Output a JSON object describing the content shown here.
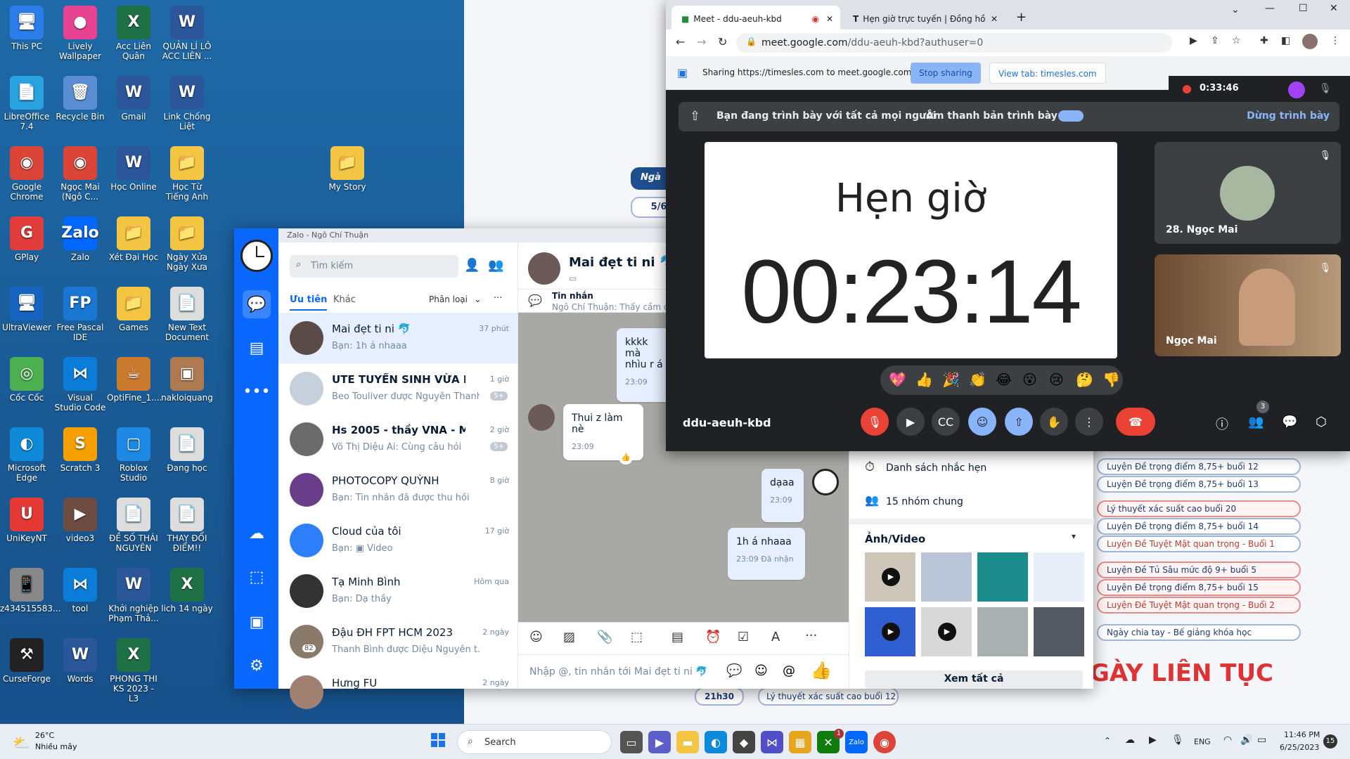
{
  "desktop": {
    "icons": [
      {
        "label": "This PC",
        "glyph": "🖥"
      },
      {
        "label": "Lively Wallpaper",
        "glyph": "●"
      },
      {
        "label": "Acc Liên Quân",
        "glyph": "X"
      },
      {
        "label": "QUẢN LÍ LÔ ACC LIÊN ...",
        "glyph": "W"
      },
      {
        "label": "LibreOffice 7.4",
        "glyph": "📄"
      },
      {
        "label": "Recycle Bin",
        "glyph": "🗑"
      },
      {
        "label": "Gmail",
        "glyph": "W"
      },
      {
        "label": "Link Chống Liệt",
        "glyph": "W"
      },
      {
        "label": "Google Chrome",
        "glyph": "◉"
      },
      {
        "label": "Ngọc Mai (Ngô C...",
        "glyph": "◉"
      },
      {
        "label": "Học Online",
        "glyph": "W"
      },
      {
        "label": "Học Từ Tiếng Anh",
        "glyph": "📁"
      },
      {
        "label": "My Story",
        "glyph": "📁"
      },
      {
        "label": "GPlay",
        "glyph": "G"
      },
      {
        "label": "Zalo",
        "glyph": "Zalo"
      },
      {
        "label": "Xét Đại Học",
        "glyph": "📁"
      },
      {
        "label": "Ngày Xửa Ngày Xưa",
        "glyph": "📁"
      },
      {
        "label": "UltraViewer",
        "glyph": "🖥"
      },
      {
        "label": "Free Pascal IDE",
        "glyph": "FP"
      },
      {
        "label": "Games",
        "glyph": "📁"
      },
      {
        "label": "New Text Document",
        "glyph": "📄"
      },
      {
        "label": "Cốc Cốc",
        "glyph": "◎"
      },
      {
        "label": "Visual Studio Code",
        "glyph": "⋈"
      },
      {
        "label": "OptiFine_1....",
        "glyph": "☕"
      },
      {
        "label": "nakloiquang",
        "glyph": "▣"
      },
      {
        "label": "Microsoft Edge",
        "glyph": "◐"
      },
      {
        "label": "Scratch 3",
        "glyph": "S"
      },
      {
        "label": "Roblox Studio",
        "glyph": "▢"
      },
      {
        "label": "Đang học",
        "glyph": "📄"
      },
      {
        "label": "UniKeyNT",
        "glyph": "U"
      },
      {
        "label": "video3",
        "glyph": "▶"
      },
      {
        "label": "ĐỀ SỐ THÁI NGUYÊN",
        "glyph": "📄"
      },
      {
        "label": "THAY ĐỔI ĐIỂM!!",
        "glyph": "📄"
      },
      {
        "label": "z434515583...",
        "glyph": "📱"
      },
      {
        "label": "tool",
        "glyph": "⋈"
      },
      {
        "label": "Khởi nghiệp Phạm Thả...",
        "glyph": "W"
      },
      {
        "label": "lich 14 ngày",
        "glyph": "X"
      },
      {
        "label": "CurseForge",
        "glyph": "⚒"
      },
      {
        "label": "Words",
        "glyph": "W"
      },
      {
        "label": "PHONG THI KS 2023 - L3",
        "glyph": "X"
      }
    ]
  },
  "website": {
    "tag1": "Ngà",
    "tag2": "5/6",
    "items": [
      "Luyện Đề trọng điểm 8,75+ buổi 12",
      "Luyện Đề trọng điểm 8,75+ buổi 13",
      "Lý thuyết xác suất cao buổi 20",
      "Luyện Đề trọng điểm 8,75+ buổi 14",
      "Luyện Đề Tuyệt Mật quan trọng - Buổi 1",
      "Luyện Đề Tủ Sâu mức độ 9+ buổi 5",
      "Luyện Đề trọng điểm 8,75+ buổi 15",
      "Luyện Đề Tuyệt Mật quan trọng - Buổi 2",
      "Ngày chia tay - Bế giảng khóa học"
    ],
    "banner": "GÀY LIÊN TỤC",
    "bottom_time": "21h30",
    "bottom_item": "Lý thuyết xác suất cao buổi 12"
  },
  "zalo": {
    "title": "Zalo - Ngô Chí Thuận",
    "search_placeholder": "Tìm kiếm",
    "tab_priority": "Ưu tiên",
    "tab_other": "Khác",
    "classify": "Phân loại",
    "conversations": [
      {
        "name": "Mai đẹt ti ni 🐬",
        "preview": "Bạn: 1h á nhaaa",
        "time": "37 phút"
      },
      {
        "name": "UTE TUYỂN SINH VỪA LÀ...",
        "preview": "Beo Touliver được Nguyễn Thanh ...",
        "time": "1 giờ"
      },
      {
        "name": "Hs 2005 - thầy VNA - Ma...",
        "preview": "Võ Thị Diệu Ái: Cùng câu hỏi",
        "time": "2 giờ"
      },
      {
        "name": "PHOTOCOPY QUỲNH",
        "preview": "Bạn: Tin nhắn đã được thu hồi",
        "time": "8 giờ"
      },
      {
        "name": "Cloud của tôi",
        "preview": "Bạn: ▣ Video",
        "time": "17 giờ"
      },
      {
        "name": "Tạ Minh Bình",
        "preview": "Bạn: Dạ thầy",
        "time": "Hôm qua"
      },
      {
        "name": "Đậu ĐH FPT HCM 2023",
        "preview": "Thanh Bình được Diệu Nguyễn t...",
        "time": "2 ngày"
      },
      {
        "name": "Hưng FU",
        "preview": "",
        "time": "2 ngày"
      }
    ],
    "badge_5": "5+",
    "badge_82": "82",
    "chat": {
      "name": "Mai đẹt ti ni 🐬",
      "pinned_label": "Tin nhắn",
      "pinned_text": "Ngô Chí Thuận: Thấy cầm c",
      "messages": [
        {
          "text": "kkkk mà nhìu r á",
          "time": "23:09"
        },
        {
          "text": "Thui z làm nè",
          "time": "23:09"
        },
        {
          "text": "dạaa",
          "time": "23:09"
        },
        {
          "text": "1h á nhaaa",
          "time": "23:09",
          "status": "Đã nhận"
        }
      ],
      "input_placeholder": "Nhập @, tin nhắn tới Mai đẹt ti ni 🐬"
    },
    "info": {
      "reminders": "Danh sách nhắc hẹn",
      "groups": "15 nhóm chung",
      "media_title": "Ảnh/Video",
      "see_all": "Xem tất cả"
    }
  },
  "chrome": {
    "tab1": "Meet - ddu-aeuh-kbd",
    "tab2": "Hẹn giờ trực tuyến | Đồng hồ",
    "url_host": "meet.google.com",
    "url_path": "/ddu-aeuh-kbd?authuser=0",
    "sharing_text": "Sharing https://timesles.com to meet.google.com",
    "stop_sharing": "Stop sharing",
    "view_tab": "View tab: timesles.com"
  },
  "meet": {
    "rec_time": "0:33:46",
    "presenting_text": "Bạn đang trình bày với tất cả mọi người",
    "present_audio": "Âm thanh bản trình bày",
    "stop_presenting": "Dừng trình bày",
    "timer_title": "Hẹn giờ",
    "timer_value": "00:23:14",
    "participant1": "28. Ngọc Mai",
    "participant2": "Ngọc Mai",
    "meeting_code": "ddu-aeuh-kbd",
    "people_count": "3",
    "reactions": [
      "💖",
      "👍",
      "🎉",
      "👏",
      "😂",
      "😮",
      "😢",
      "🤔",
      "👎"
    ]
  },
  "taskbar": {
    "weather_temp": "26°C",
    "weather_text": "Nhiều mây",
    "search": "Search",
    "lang": "ENG",
    "time": "11:46 PM",
    "date": "6/25/2023",
    "notif": "15",
    "xbox_badge": "1"
  }
}
